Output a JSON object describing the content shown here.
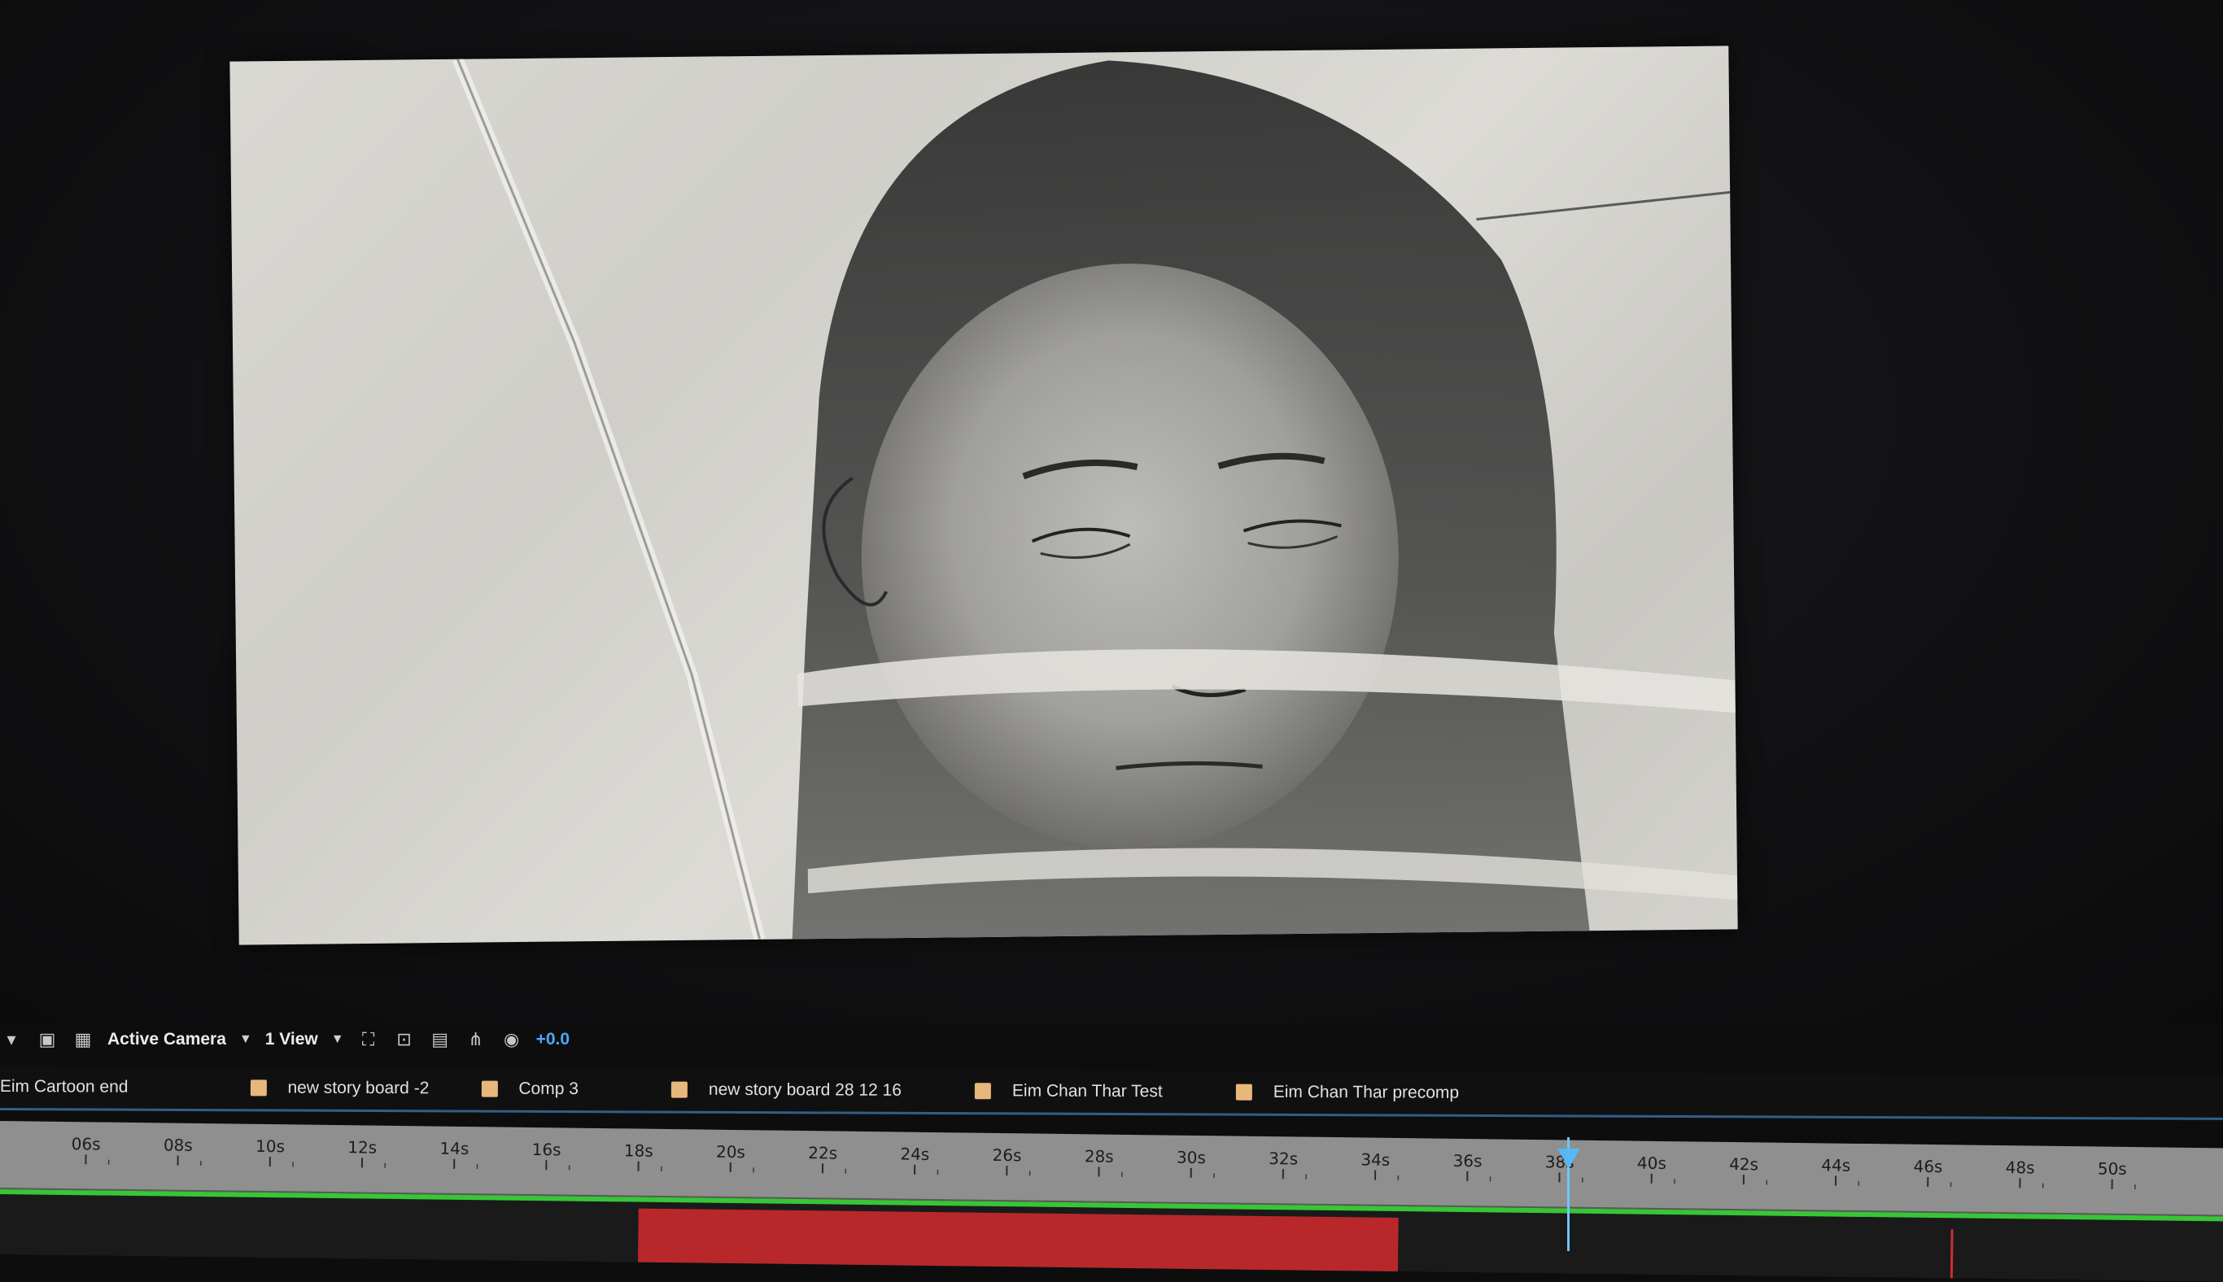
{
  "viewer": {
    "icons": [
      "chevron-down-icon",
      "region-icon",
      "transparency-grid-icon",
      "reset-icon",
      "fast-preview-icon",
      "3d-view-icon",
      "flowchart-icon",
      "exposure-icon"
    ]
  },
  "viewer_toolbar": {
    "camera_label": "Active Camera",
    "view_label": "1 View",
    "exposure_value": "+0.0"
  },
  "comp_tabs": [
    {
      "label": "Eim Cartoon end",
      "swatch": false
    },
    {
      "label": "new story board -2",
      "swatch": true
    },
    {
      "label": "Comp 3",
      "swatch": true
    },
    {
      "label": "new story board 28 12 16",
      "swatch": true
    },
    {
      "label": "Eim Chan Thar Test",
      "swatch": true
    },
    {
      "label": "Eim Chan Thar precomp",
      "swatch": true
    }
  ],
  "colors": {
    "tab_swatch": "#e8b77c",
    "work_area": "#38c637",
    "layer_bar": "#b8282a",
    "playhead": "#56b8f5",
    "exposure_text": "#4fa6ff"
  },
  "timeline": {
    "tick_labels": [
      "06s",
      "08s",
      "10s",
      "12s",
      "14s",
      "16s",
      "18s",
      "20s",
      "22s",
      "24s",
      "26s",
      "28s",
      "30s",
      "32s",
      "34s",
      "36s",
      "38s",
      "40s",
      "42s",
      "44s",
      "46s",
      "48s",
      "50s"
    ],
    "playhead_label": "38s",
    "layer_bar_start_s": 18,
    "layer_bar_end_s": 34.5,
    "playhead_s": 37.6,
    "end_marker_s": 46.5
  }
}
